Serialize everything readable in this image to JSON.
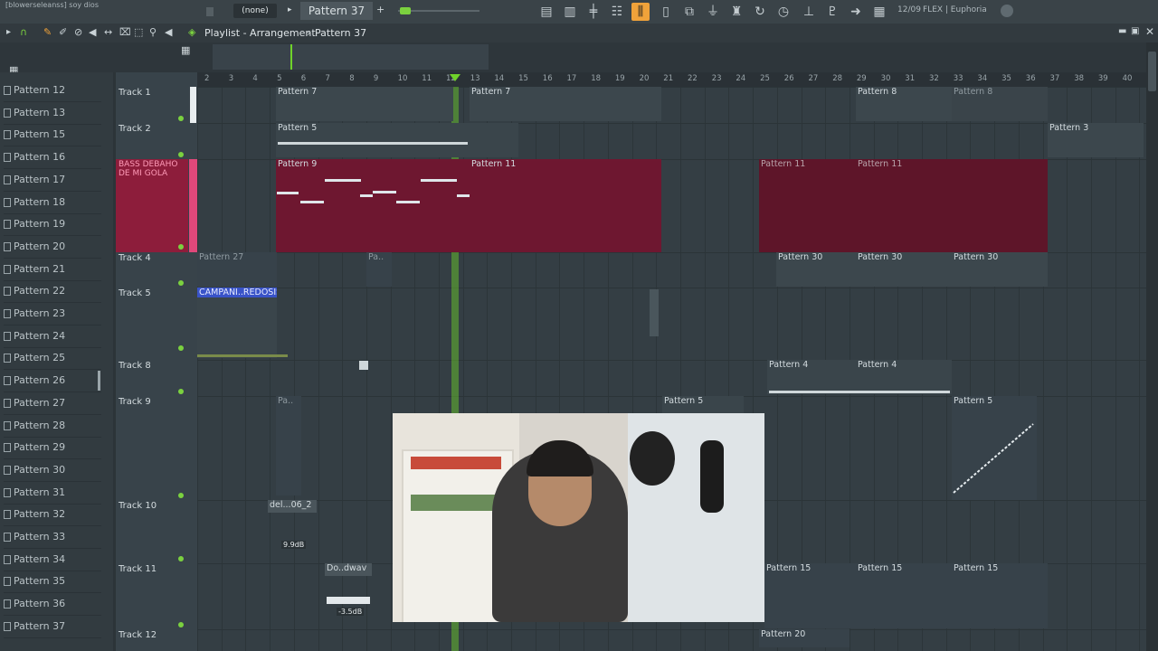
{
  "topbar": {
    "song_hint": "[blowerseleanss] soy  dios",
    "pattern_selector_value": "(none)",
    "current_pattern": "Pattern 37",
    "counter": "12/09",
    "plugin_hint": "FLEX | Euphoria"
  },
  "titlebar": {
    "breadcrumb_view": "Playlist - Arrangement",
    "breadcrumb_pattern": "Pattern 37"
  },
  "sidebar": {
    "patterns": [
      "Pattern 12",
      "Pattern 13",
      "Pattern 15",
      "Pattern 16",
      "Pattern 17",
      "Pattern 18",
      "Pattern 19",
      "Pattern 20",
      "Pattern 21",
      "Pattern 22",
      "Pattern 23",
      "Pattern 24",
      "Pattern 25",
      "Pattern 26",
      "Pattern 27",
      "Pattern 28",
      "Pattern 29",
      "Pattern 30",
      "Pattern 31",
      "Pattern 32",
      "Pattern 33",
      "Pattern 34",
      "Pattern 35",
      "Pattern 36",
      "Pattern 37"
    ]
  },
  "tracks": [
    {
      "name": "Track 1"
    },
    {
      "name": "Track 2"
    },
    {
      "name": "BASS DEBAHO DE MI GOLA"
    },
    {
      "name": "Track 4"
    },
    {
      "name": "Track 5"
    },
    {
      "name": "Track 8"
    },
    {
      "name": "Track 9"
    },
    {
      "name": "Track 10"
    },
    {
      "name": "Track 11"
    },
    {
      "name": "Track 12"
    }
  ],
  "ruler": {
    "bars": [
      "2",
      "3",
      "4",
      "5",
      "6",
      "7",
      "8",
      "9",
      "10",
      "11",
      "12",
      "13",
      "14",
      "15",
      "16",
      "17",
      "18",
      "19",
      "20",
      "21",
      "22",
      "23",
      "24",
      "25",
      "26",
      "27",
      "28",
      "29",
      "30",
      "31",
      "32",
      "33",
      "34",
      "35",
      "36",
      "37",
      "38",
      "39",
      "40"
    ]
  },
  "clips": {
    "c1": "Pattern 7",
    "c2": "Pattern 7",
    "c3": "Pattern 8",
    "c4": "Pattern 8",
    "c5": "Pattern 5",
    "c6": "Pattern 3",
    "c7": "Pattern 9",
    "c8": "Pattern 11",
    "c9": "Pattern 11",
    "c10": "Pattern 11",
    "c11": "Pattern 27",
    "c12": "Pa..",
    "c13": "Pattern 30",
    "c14": "Pattern 30",
    "c15": "Pattern 30",
    "c16": "CAMPANI..REDOSIS",
    "c17": "Pattern 4",
    "c18": "Pattern 4",
    "c19": "Pa..",
    "c20": "Pattern 5",
    "c21": "Pattern 5",
    "c22": "del...06_2",
    "c23": "9.9dB",
    "c24": "Do..dwav",
    "c25": "-3.5dB",
    "c26": "Pattern 15",
    "c27": "Pattern 15",
    "c28": "Pattern 15",
    "c29": "Pattern 20"
  },
  "colors": {
    "accent": "#f0a23a",
    "bass_track": "#e0487a",
    "playhead": "#6fd32a",
    "track_dot": "#7bd13f"
  },
  "icons": [
    "play-icon",
    "record-icon",
    "pencil-icon",
    "brush-icon",
    "delete-icon",
    "mute-icon",
    "slip-icon",
    "slice-icon",
    "select-icon",
    "zoom-icon",
    "speaker-icon",
    "playlist-icon",
    "piano-icon",
    "mixer-icon",
    "channel-rack-icon",
    "browser-icon",
    "plugin-icon",
    "metronome-icon",
    "loop-icon",
    "minimize-icon",
    "maximize-icon",
    "close-icon"
  ]
}
